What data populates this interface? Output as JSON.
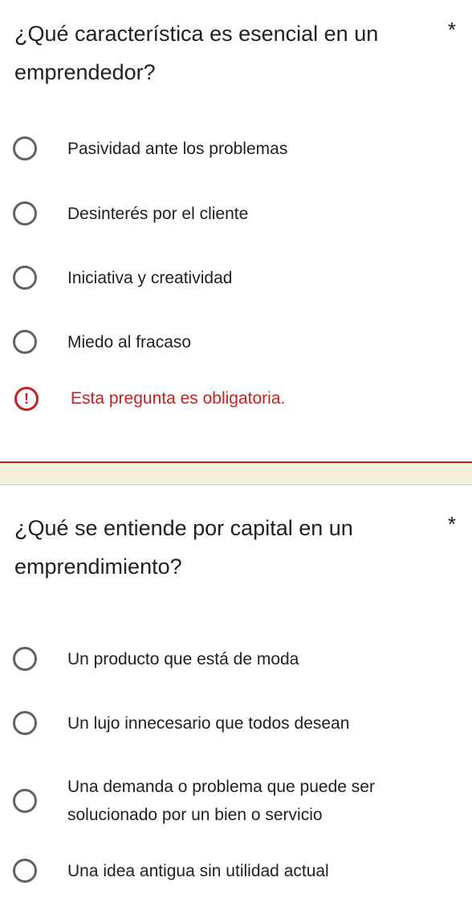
{
  "questions": [
    {
      "title": "¿Qué característica es esencial en un emprendedor?",
      "required_marker": "*",
      "options": [
        "Pasividad ante los problemas",
        "Desinterés por el cliente",
        "Iniciativa y creatividad",
        "Miedo al fracaso"
      ],
      "error_icon": "!",
      "error_message": "Esta pregunta es obligatoria."
    },
    {
      "title": "¿Qué se entiende por capital en un emprendimiento?",
      "required_marker": "*",
      "options": [
        "Un producto que está de moda",
        "Un lujo innecesario que todos desean",
        "Una demanda o problema que puede ser solucionado por un bien o servicio",
        "Una idea antigua sin utilidad actual"
      ]
    }
  ],
  "colors": {
    "error": "#c5221f",
    "separator": "#f5f0dc",
    "radio_border": "#5f6368",
    "text": "#202124"
  }
}
